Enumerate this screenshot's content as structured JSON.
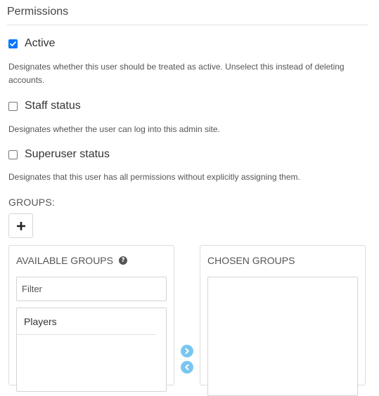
{
  "section": {
    "title": "Permissions"
  },
  "active": {
    "label": "Active",
    "checked": true,
    "help": "Designates whether this user should be treated as active. Unselect this instead of deleting accounts."
  },
  "staff": {
    "label": "Staff status",
    "checked": false,
    "help": "Designates whether the user can log into this admin site."
  },
  "superuser": {
    "label": "Superuser status",
    "checked": false,
    "help": "Designates that this user has all permissions without explicitly assigning them."
  },
  "groups": {
    "label": "GROUPS:",
    "add_icon": "plus-icon",
    "available": {
      "title": "AVAILABLE GROUPS",
      "help_icon": "question-circle-icon",
      "filter_placeholder": "Filter",
      "options": [
        "Players"
      ]
    },
    "chosen": {
      "title": "CHOSEN GROUPS",
      "options": []
    },
    "choose_icon": "chevron-right-circle-icon",
    "remove_icon": "chevron-left-circle-icon"
  },
  "colors": {
    "checkbox_checked": "#0075ff",
    "arrow_button": "#79c7f0",
    "border": "#dcdcdc"
  }
}
